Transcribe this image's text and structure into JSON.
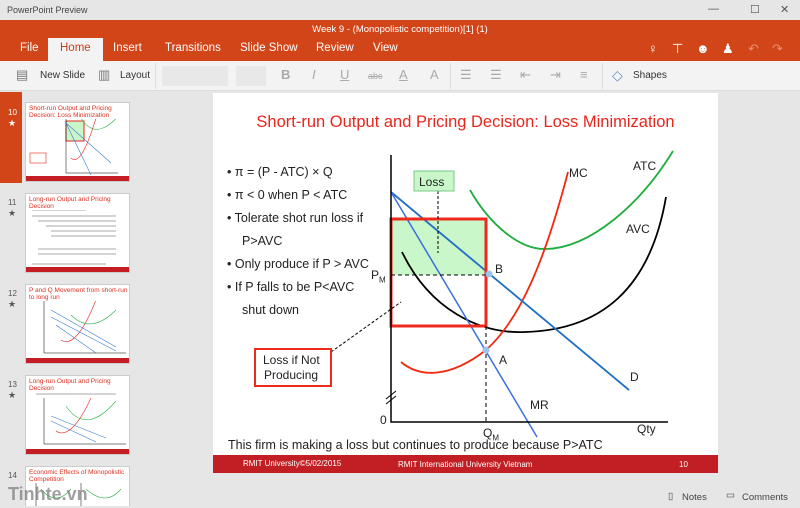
{
  "app": {
    "name": "PowerPoint Preview",
    "doc_title": "Week 9 - (Monopolistic competition)[1] (1)"
  },
  "window_controls": [
    "—",
    "☐",
    "✕"
  ],
  "tabs": [
    {
      "label": "File"
    },
    {
      "label": "Home",
      "active": true
    },
    {
      "label": "Insert"
    },
    {
      "label": "Transitions"
    },
    {
      "label": "Slide Show"
    },
    {
      "label": "Review"
    },
    {
      "label": "View"
    }
  ],
  "ribbon": {
    "new_slide": "New Slide",
    "layout": "Layout",
    "bold": "B",
    "italic": "I",
    "underline": "U",
    "strike": "abc",
    "font_color": "A",
    "clear": "A",
    "shapes": "Shapes"
  },
  "accent": "#d24519",
  "thumbnails": [
    {
      "num": "10",
      "title": "Short-run Output and Pricing Decision: Loss Minimization",
      "selected": true
    },
    {
      "num": "11",
      "title": "Long-run Output and Pricing Decision"
    },
    {
      "num": "12",
      "title": "P and Q Movement from short-run to long run"
    },
    {
      "num": "13",
      "title": "Long-run Output and Pricing Decision"
    },
    {
      "num": "14",
      "title": "Economic Effects of Monopolistic Competition"
    }
  ],
  "slide": {
    "title": "Short-run Output and Pricing Decision: Loss Minimization",
    "bullets": [
      "π = (P - ATC) × Q",
      "π < 0 when P < ATC",
      "Tolerate shot run loss if",
      "P>AVC",
      "Only produce if P > AVC",
      "If P falls to be P<AVC",
      "shut down"
    ],
    "labels": {
      "loss": "Loss",
      "loss_not_producing_1": "Loss if Not",
      "loss_not_producing_2": "Producing",
      "mc": "MC",
      "atc": "ATC",
      "avc": "AVC",
      "d": "D",
      "mr": "MR",
      "b": "B",
      "a": "A",
      "pm": "P",
      "pm_sub": "M",
      "qm": "Q",
      "qm_sub": "M",
      "qty": "Qty",
      "zero": "0"
    },
    "caption": "This firm is making a loss but continues to produce because P>ATC",
    "footer": {
      "left": "RMIT University©5/02/2015",
      "center": "RMIT International University Vietnam",
      "page": "10"
    }
  },
  "statusbar": {
    "notes": "Notes",
    "comments": "Comments"
  },
  "watermark": "Tinhte.vn"
}
